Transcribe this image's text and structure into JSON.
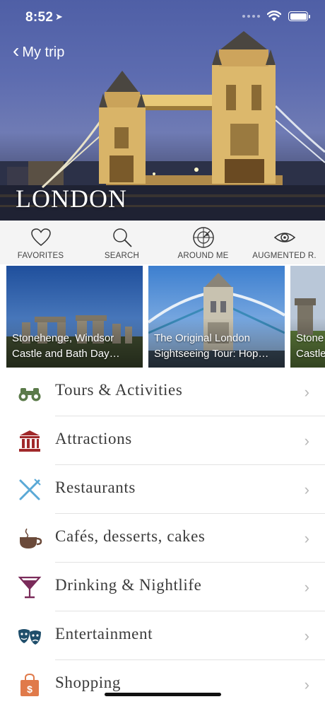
{
  "status_bar": {
    "time": "8:52"
  },
  "header": {
    "back_label": "My trip",
    "city": "LONDON"
  },
  "toolbar": [
    {
      "label": "FAVORITES",
      "icon": "heart-icon"
    },
    {
      "label": "SEARCH",
      "icon": "search-icon"
    },
    {
      "label": "AROUND ME",
      "icon": "radar-icon"
    },
    {
      "label": "AUGMENTED R.",
      "icon": "eye-icon"
    }
  ],
  "tours": [
    {
      "caption": "Stonehenge, Windsor\nCastle and Bath Day…"
    },
    {
      "caption": "The Original London\nSightseeing Tour: Hop…"
    },
    {
      "caption": "Stone\nCastle"
    }
  ],
  "categories": [
    {
      "label": "Tours & Activities",
      "icon": "binoculars-icon",
      "color": "#5b7a4a"
    },
    {
      "label": "Attractions",
      "icon": "museum-icon",
      "color": "#a0282a"
    },
    {
      "label": "Restaurants",
      "icon": "fork-knife-icon",
      "color": "#5aa9d6"
    },
    {
      "label": "Cafés, desserts, cakes",
      "icon": "coffee-cup-icon",
      "color": "#6b4a3a"
    },
    {
      "label": "Drinking & Nightlife",
      "icon": "cocktail-icon",
      "color": "#7a2b5a"
    },
    {
      "label": "Entertainment",
      "icon": "theater-masks-icon",
      "color": "#1f4e6b"
    },
    {
      "label": "Shopping",
      "icon": "shopping-bag-icon",
      "color": "#e07a4a"
    }
  ]
}
